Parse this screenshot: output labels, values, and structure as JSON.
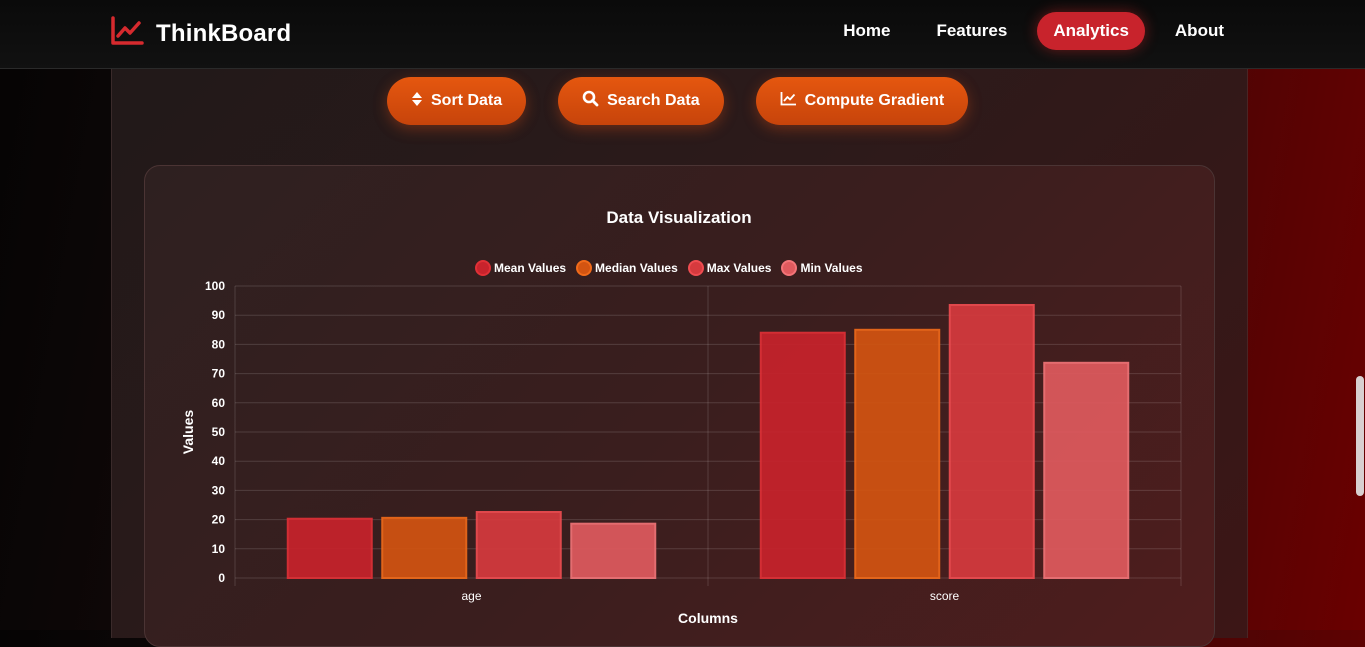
{
  "nav": {
    "brand": "ThinkBoard",
    "links": [
      {
        "label": "Home"
      },
      {
        "label": "Features"
      },
      {
        "label": "Analytics"
      },
      {
        "label": "About"
      }
    ]
  },
  "actions": {
    "sort": "Sort Data",
    "search": "Search Data",
    "gradient": "Compute Gradient"
  },
  "colors": {
    "mean": "#c8232c",
    "median": "#d35411",
    "max": "#d63a3e",
    "min": "#df5a5e"
  },
  "chart_data": {
    "type": "bar",
    "title": "Data Visualization",
    "xlabel": "Columns",
    "ylabel": "Values",
    "categories": [
      "age",
      "score"
    ],
    "ylim": [
      0,
      100
    ],
    "yticks": [
      0,
      10,
      20,
      30,
      40,
      50,
      60,
      70,
      80,
      90,
      100
    ],
    "grid": true,
    "legend_position": "top",
    "series": [
      {
        "name": "Mean Values",
        "values": [
          20.3,
          84
        ]
      },
      {
        "name": "Median Values",
        "values": [
          20.6,
          85
        ]
      },
      {
        "name": "Max Values",
        "values": [
          22.6,
          93.5
        ]
      },
      {
        "name": "Min Values",
        "values": [
          18.6,
          73.7
        ]
      }
    ]
  }
}
